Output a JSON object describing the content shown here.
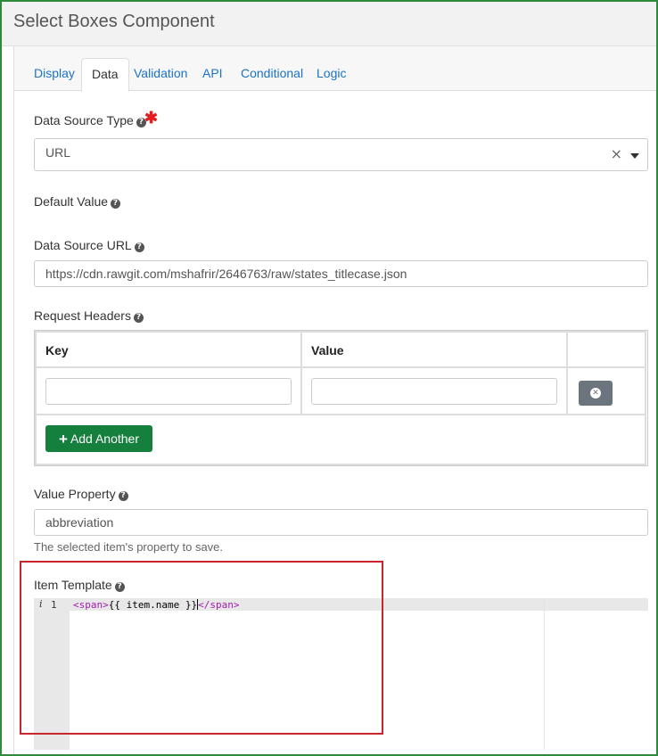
{
  "window": {
    "title": "Select Boxes Component"
  },
  "tabs": [
    {
      "label": "Display"
    },
    {
      "label": "Data"
    },
    {
      "label": "Validation"
    },
    {
      "label": "API"
    },
    {
      "label": "Conditional"
    },
    {
      "label": "Logic"
    }
  ],
  "active_tab": "Data",
  "fields": {
    "data_source_type": {
      "label": "Data Source Type",
      "value": "URL",
      "required": true,
      "clear_glyph": "×"
    },
    "default_value": {
      "label": "Default Value"
    },
    "data_source_url": {
      "label": "Data Source URL",
      "value": "https://cdn.rawgit.com/mshafrir/2646763/raw/states_titlecase.json"
    },
    "request_headers": {
      "label": "Request Headers",
      "columns": [
        "Key",
        "Value"
      ],
      "rows": [
        {
          "key": "",
          "value": ""
        }
      ],
      "add_button": {
        "icon": "plus-icon",
        "glyph": "+",
        "label": "Add Another"
      }
    },
    "value_property": {
      "label": "Value Property",
      "value": "abbreviation",
      "description": "The selected item's property to save."
    },
    "item_template": {
      "label": "Item Template",
      "gutter_info": "i",
      "line_number": "1",
      "code_open_tag": "<span>",
      "code_text": "{{ item.name }}",
      "code_close_tag": "</span>"
    }
  },
  "colors": {
    "frame_border": "#2e8b3e",
    "link": "#1a73c8",
    "required": "#e02020",
    "add_button": "#157f3e",
    "remove_button": "#6c757d",
    "highlight_box": "#c8252f",
    "code_tag": "#a31daf"
  }
}
